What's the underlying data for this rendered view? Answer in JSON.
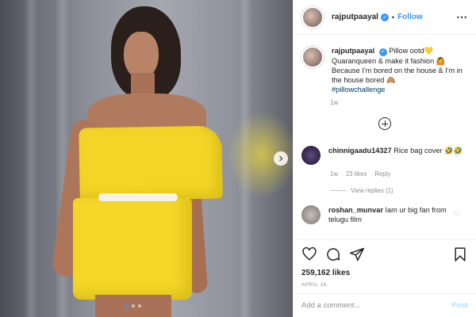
{
  "header": {
    "username": "rajputpaayal",
    "separator": "•",
    "follow_label": "Follow",
    "more_label": "⋯"
  },
  "caption": {
    "username": "rajputpaayal",
    "text": "Pillow ootd💛 Quaranqueen & make it fashion 🙆 Because I'm bored on the house & I'm in the house bored 🙈",
    "hashtag": "#pillowchallenge",
    "time": "1w"
  },
  "comments": [
    {
      "username": "chinnigaadu14327",
      "text": "Rice bag cover 🤣🤣",
      "time": "1w",
      "likes": "23 likes",
      "reply_label": "Reply",
      "view_replies": "View replies (1)"
    },
    {
      "username": "roshan_munvar",
      "text": "Iam ur big fan from telugu film"
    }
  ],
  "post": {
    "likes": "259,162 likes",
    "date": "APRIL 16"
  },
  "comment_box": {
    "placeholder": "Add a comment...",
    "post_label": "Post"
  },
  "carousel": {
    "current": 1,
    "total": 3
  },
  "colors": {
    "accent": "#3897f0",
    "pillow": "#f4d728"
  },
  "icons": [
    "more-options-icon",
    "verified-badge-icon",
    "add-icon",
    "heart-icon",
    "comment-icon",
    "share-icon",
    "bookmark-icon",
    "next-arrow-icon"
  ]
}
